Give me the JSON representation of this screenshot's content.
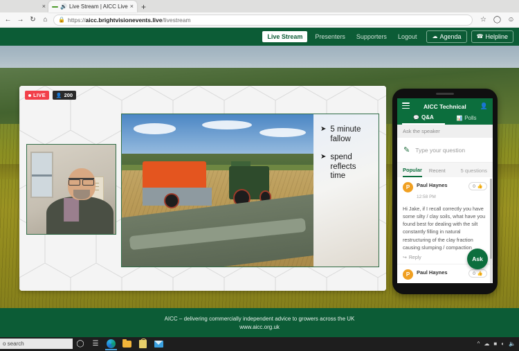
{
  "browser": {
    "tab": {
      "title": "Live Stream | AICC Live",
      "favicon_icon": "audio-playing-icon",
      "audio_icon": "speaker-icon",
      "close_icon": "close-icon"
    },
    "new_tab_label": "+",
    "other_tab_close": "×",
    "toolbar": {
      "back_icon": "back-arrow-icon",
      "forward_icon": "forward-arrow-icon",
      "refresh_icon": "refresh-icon",
      "home_icon": "home-icon",
      "lock_icon": "padlock-icon",
      "url_prefix": "https://",
      "url_host": "aicc.brightvisionevents.live",
      "url_path": "/livestream",
      "star_icon": "favorite-star-icon",
      "collections_icon": "collections-icon",
      "profile_icon": "profile-icon"
    }
  },
  "nav": {
    "links": [
      {
        "label": "Live Stream",
        "active": true
      },
      {
        "label": "Presenters",
        "active": false
      },
      {
        "label": "Supporters",
        "active": false
      },
      {
        "label": "Logout",
        "active": false
      }
    ],
    "buttons": [
      {
        "label": "Agenda",
        "icon": "agenda-calendar-icon",
        "glyph": "☁"
      },
      {
        "label": "Helpline",
        "icon": "phone-helpline-icon",
        "glyph": "☎"
      }
    ]
  },
  "stage": {
    "live_badge": "LIVE",
    "viewer_count": "200",
    "viewer_icon": "person-icon",
    "webcam_label": "presenter-webcam",
    "slide": {
      "photo_alt": "tractor-seed-drill-in-stubble-field",
      "bullets": [
        {
          "marker": "➤",
          "text": "5 minute fallow"
        },
        {
          "marker": "➤",
          "text": "spend reflects time"
        }
      ]
    }
  },
  "phone": {
    "app_title": "AICC Technical",
    "menu_icon": "hamburger-menu-icon",
    "profile_icon": "person-icon",
    "tabs": [
      {
        "label": "Q&A",
        "icon": "speech-bubble-icon",
        "glyph": "💬",
        "active": true
      },
      {
        "label": "Polls",
        "icon": "bar-chart-icon",
        "glyph": "▂▆▄",
        "active": false
      }
    ],
    "ask_strip": "Ask the speaker",
    "compose": {
      "placeholder": "Type your question",
      "icon": "compose-pencil-icon",
      "glyph": "✎"
    },
    "filters": [
      {
        "label": "Popular",
        "active": true
      },
      {
        "label": "Recent",
        "active": false
      }
    ],
    "question_count": "5 questions",
    "questions": [
      {
        "avatar_letter": "P",
        "name": "Paul Haynes",
        "time": "12:58 PM",
        "votes": "0",
        "vote_icon": "thumbs-up-icon",
        "body": "Hi Jake, if I recall correctly you have some silty / clay soils, what have you found best for dealing with the silt constantly filling in natural restructuring of the clay fraction causing slumping / compaction",
        "reply_label": "Reply",
        "reply_icon": "reply-arrow-icon"
      },
      {
        "avatar_letter": "P",
        "name": "Paul Haynes",
        "time": "",
        "votes": "0",
        "vote_icon": "thumbs-up-icon",
        "body": "",
        "reply_label": "",
        "reply_icon": "reply-arrow-icon"
      }
    ],
    "fab_label": "Ask"
  },
  "footer": {
    "line1": "AICC – delivering commercially independent advice to growers across the UK",
    "line2": "www.aicc.org.uk"
  },
  "taskbar": {
    "search_placeholder": "o search",
    "cortana_icon": "cortana-circle-icon",
    "taskview_icon": "task-view-icon",
    "apps": [
      {
        "name": "edge-icon",
        "active": true
      },
      {
        "name": "file-explorer-icon",
        "active": false
      },
      {
        "name": "microsoft-store-icon",
        "active": false
      },
      {
        "name": "mail-icon",
        "active": false
      }
    ],
    "tray": [
      "show-hidden-icons",
      "onedrive-icon",
      "battery-icon",
      "network-icon",
      "volume-icon"
    ]
  },
  "colors": {
    "brand_green": "#0c5c36",
    "app_green": "#0c6e3d",
    "live_red": "#f2404a",
    "avatar_orange": "#f0a022"
  }
}
